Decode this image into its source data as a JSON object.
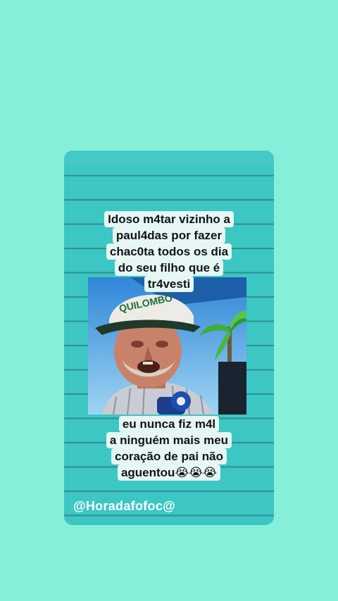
{
  "post": {
    "caption_top_lines": [
      "Idoso m4tar vizinho a",
      "paul4das por fazer",
      "chac0ta todos os dia",
      "do seu filho que é",
      "tr4vesti"
    ],
    "caption_bottom_lines": [
      "eu nunca fiz m4l",
      "a ninguém mais meu",
      "coração de pai não",
      "aguentou😭😭😭"
    ],
    "cap_text": "QUILOMBO",
    "handle": "@Horadafofoc@"
  },
  "colors": {
    "page_bg": "#86efd9",
    "card_bg": "#3cc6c4",
    "card_lines": "#2f8f8c",
    "caption_bg": "#e6f6f2"
  }
}
